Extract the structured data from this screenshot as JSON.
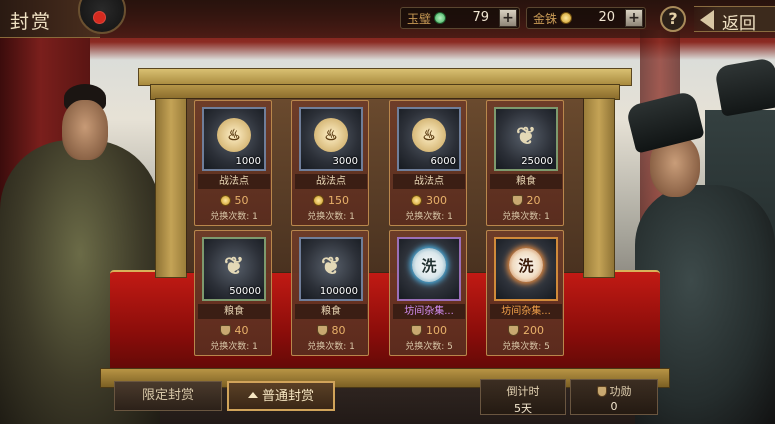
{
  "header": {
    "title": "封赏",
    "currencies": [
      {
        "label": "玉璧",
        "value": "79",
        "icon": "jade-disc-icon",
        "color": "#3cae5a"
      },
      {
        "label": "金铢",
        "value": "20",
        "icon": "gold-coin-icon",
        "color": "#d8a828"
      }
    ],
    "help_label": "?",
    "back_label": "返回"
  },
  "items": [
    {
      "name": "战法点",
      "amount": "1000",
      "cost": "50",
      "cost_icon": "gold-coin-icon",
      "limit": "兑换次数: 1",
      "icon": "flame-icon",
      "rarity": "blue"
    },
    {
      "name": "战法点",
      "amount": "3000",
      "cost": "150",
      "cost_icon": "gold-coin-icon",
      "limit": "兑换次数: 1",
      "icon": "flame-icon",
      "rarity": "blue"
    },
    {
      "name": "战法点",
      "amount": "6000",
      "cost": "300",
      "cost_icon": "gold-coin-icon",
      "limit": "兑换次数: 1",
      "icon": "flame-icon",
      "rarity": "blue"
    },
    {
      "name": "粮食",
      "amount": "25000",
      "cost": "20",
      "cost_icon": "merit-shield-icon",
      "limit": "兑换次数: 1",
      "icon": "grain-icon",
      "rarity": "green"
    },
    {
      "name": "粮食",
      "amount": "50000",
      "cost": "40",
      "cost_icon": "merit-shield-icon",
      "limit": "兑换次数: 1",
      "icon": "grain-icon",
      "rarity": "green"
    },
    {
      "name": "粮食",
      "amount": "100000",
      "cost": "80",
      "cost_icon": "merit-shield-icon",
      "limit": "兑换次数: 1",
      "icon": "grain-icon",
      "rarity": "green"
    },
    {
      "name": "坊间杂集...",
      "amount": "",
      "glyph": "洗",
      "cost": "100",
      "cost_icon": "merit-shield-icon",
      "limit": "兑换次数: 5",
      "icon": "wash-token-icon",
      "rarity": "purple"
    },
    {
      "name": "坊间杂集...",
      "amount": "",
      "glyph": "洗",
      "cost": "200",
      "cost_icon": "merit-shield-icon",
      "limit": "兑换次数: 5",
      "icon": "wash-token-icon",
      "rarity": "orange"
    }
  ],
  "footer": {
    "tabs": [
      {
        "label": "限定封赏",
        "active": false
      },
      {
        "label": "普通封赏",
        "active": true
      }
    ],
    "countdown_label": "倒计时",
    "countdown_value": "5天",
    "merit_label": "功勋",
    "merit_value": "0"
  },
  "colors": {
    "accent_gold": "#d1a45a",
    "rare_purple": "#d28ef2",
    "rare_orange": "#f0a04a",
    "cloth_red": "#c21a14"
  }
}
